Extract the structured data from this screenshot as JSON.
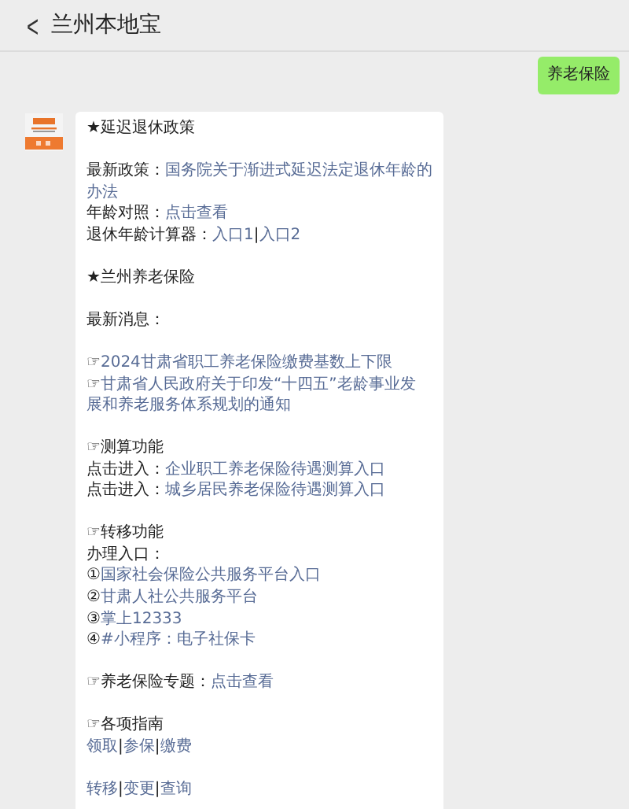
{
  "header": {
    "back": "<",
    "title": "兰州本地宝"
  },
  "messages": [
    {
      "kind": "outgoing",
      "text": "养老保险"
    },
    {
      "kind": "incoming",
      "paragraphs": [
        [
          [
            {
              "text": "★延迟退休政策",
              "kind": "plain"
            }
          ]
        ],
        [
          [
            {
              "text": "最新政策：",
              "kind": "plain"
            },
            {
              "text": "国务院关于渐进式延迟法定退休年龄的",
              "kind": "link"
            }
          ],
          [
            {
              "text": "办法",
              "kind": "link"
            }
          ],
          [
            {
              "text": "年龄对照：",
              "kind": "plain"
            },
            {
              "text": "点击查看",
              "kind": "link"
            }
          ],
          [
            {
              "text": "退休年龄计算器：",
              "kind": "plain"
            },
            {
              "text": "入口1",
              "kind": "link"
            },
            {
              "text": "|",
              "kind": "plain"
            },
            {
              "text": "入口2",
              "kind": "link"
            }
          ]
        ],
        [
          [
            {
              "text": "★兰州养老保险",
              "kind": "plain"
            }
          ]
        ],
        [
          [
            {
              "text": "最新消息：",
              "kind": "plain"
            }
          ]
        ],
        [
          [
            {
              "text": "☞",
              "kind": "plain"
            },
            {
              "text": "2024甘肃省职工养老保险缴费基数上下限",
              "kind": "link"
            }
          ],
          [
            {
              "text": "☞",
              "kind": "plain"
            },
            {
              "text": "甘肃省人民政府关于印发“十四五”老龄事业发",
              "kind": "link"
            }
          ],
          [
            {
              "text": "展和养老服务体系规划的通知",
              "kind": "link"
            }
          ]
        ],
        [
          [
            {
              "text": "☞测算功能",
              "kind": "plain"
            }
          ],
          [
            {
              "text": "点击进入：",
              "kind": "plain"
            },
            {
              "text": "企业职工养老保险待遇测算入口",
              "kind": "link"
            }
          ],
          [
            {
              "text": "点击进入：",
              "kind": "plain"
            },
            {
              "text": "城乡居民养老保险待遇测算入口",
              "kind": "link"
            }
          ]
        ],
        [
          [
            {
              "text": "☞转移功能",
              "kind": "plain"
            }
          ],
          [
            {
              "text": "办理入口：",
              "kind": "plain"
            }
          ],
          [
            {
              "text": "①",
              "kind": "plain"
            },
            {
              "text": "国家社会保险公共服务平台入口",
              "kind": "link"
            }
          ],
          [
            {
              "text": "②",
              "kind": "plain"
            },
            {
              "text": "甘肃人社公共服务平台",
              "kind": "link"
            }
          ],
          [
            {
              "text": "③",
              "kind": "plain"
            },
            {
              "text": "掌上12333",
              "kind": "link"
            }
          ],
          [
            {
              "text": "④",
              "kind": "plain"
            },
            {
              "text": "#小程序：电子社保卡",
              "kind": "link"
            }
          ]
        ],
        [
          [
            {
              "text": "☞养老保险专题：",
              "kind": "plain"
            },
            {
              "text": "点击查看",
              "kind": "link"
            }
          ]
        ],
        [
          [
            {
              "text": "☞各项指南",
              "kind": "plain"
            }
          ],
          [
            {
              "text": "领取",
              "kind": "link"
            },
            {
              "text": "|",
              "kind": "plain"
            },
            {
              "text": "参保",
              "kind": "link"
            },
            {
              "text": "|",
              "kind": "plain"
            },
            {
              "text": "缴费",
              "kind": "link"
            }
          ]
        ],
        [
          [
            {
              "text": "转移",
              "kind": "link"
            },
            {
              "text": "|",
              "kind": "plain"
            },
            {
              "text": "变更",
              "kind": "link"
            },
            {
              "text": "|",
              "kind": "plain"
            },
            {
              "text": "查询",
              "kind": "link"
            }
          ]
        ]
      ]
    }
  ]
}
